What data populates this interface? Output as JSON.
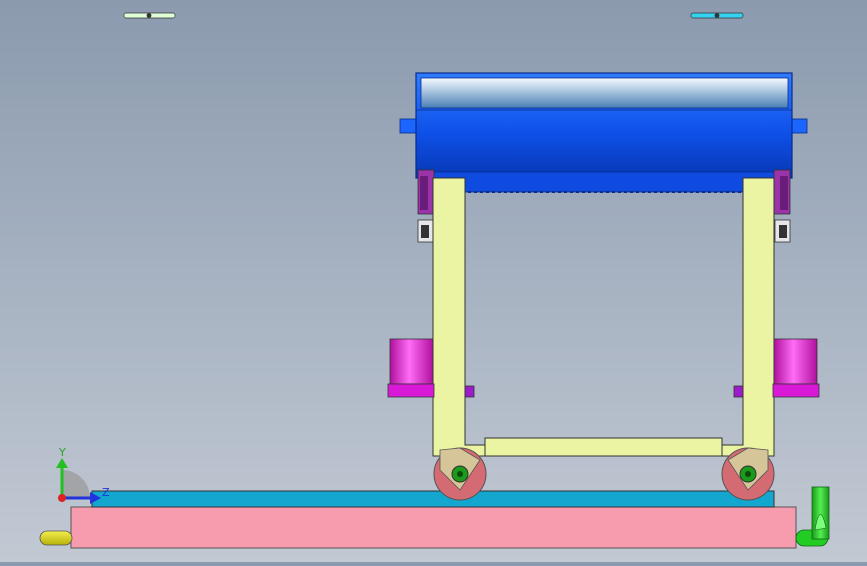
{
  "window": {
    "title": ""
  },
  "viewport": {
    "background_top": "#8b9aae",
    "background_bottom": "#c2c9d3",
    "handles": [
      {
        "name": "left-axis-handle",
        "color": "#dfffd8"
      },
      {
        "name": "right-axis-handle",
        "color": "#34d2f0"
      }
    ]
  },
  "triad": {
    "y_label": "Y",
    "z_label": "Z",
    "y_color": "#22c022",
    "z_color": "#2233dd",
    "origin_color": "#dd2222"
  },
  "model": {
    "roller_color": "#1257f0",
    "frame_color": "#eaf4a2",
    "wheel_color": "#d46b72",
    "hub_color": "#1c9a1c",
    "clamp_color": "#d81ad8",
    "rail_color": "#13a6cf",
    "base_color": "#f79bae",
    "left_fitting_color": "#e7e41f",
    "right_fitting_color": "#22cc22"
  }
}
